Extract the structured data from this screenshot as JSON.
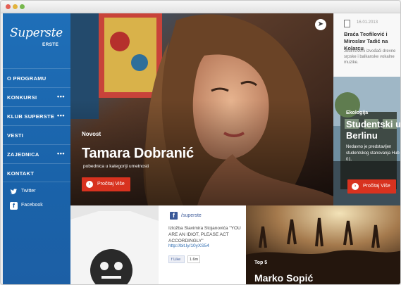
{
  "sidebar": {
    "logo": {
      "brand": "Superste",
      "sub": "ERSTE"
    },
    "nav": [
      {
        "label": "O PROGRAMU",
        "has_more": false
      },
      {
        "label": "KONKURSI",
        "has_more": true
      },
      {
        "label": "KLUB SUPERSTE",
        "has_more": true
      },
      {
        "label": "VESTI",
        "has_more": false
      },
      {
        "label": "ZAJEDNICA",
        "has_more": true
      },
      {
        "label": "KONTAKT",
        "has_more": false
      }
    ],
    "more_glyph": "•••",
    "social": [
      {
        "label": "Twitter",
        "icon": "twitter-icon"
      },
      {
        "label": "Facebook",
        "icon": "facebook-icon"
      }
    ]
  },
  "hero": {
    "tag": "Novost",
    "title": "Tamara Dobranić",
    "subtitle": "pobednica u kategoriji umetnosti",
    "button": "Pročitaj Više"
  },
  "news": {
    "date": "16.01.2013",
    "title": "Braća Teofilović i Miroslav Tadić na Kolarcu",
    "text": "Jedinstveni izvođači drevne srpske i balkanske vokalne muzike."
  },
  "story2": {
    "tag": "Ekologija",
    "title": "Studentski u Berlinu",
    "text": "Nedavno je predstavljen studentskog stanovanja Hub 01.",
    "button": "Pročitaj Više"
  },
  "facebook": {
    "handle": "/superste",
    "post": "Izložba Slavimira Stojanovića \"YOU ARE AN IDIOT, PLEASE ACT ACCORDINGLY\"",
    "link": "http://bit.ly/10yXS54",
    "like_label": "Like",
    "like_count": "1.6m"
  },
  "concert": {
    "tag": "Top 5",
    "title": "Marko Sopić"
  },
  "colors": {
    "brand_blue": "#1f6fb8",
    "accent_red": "#d8321f"
  }
}
